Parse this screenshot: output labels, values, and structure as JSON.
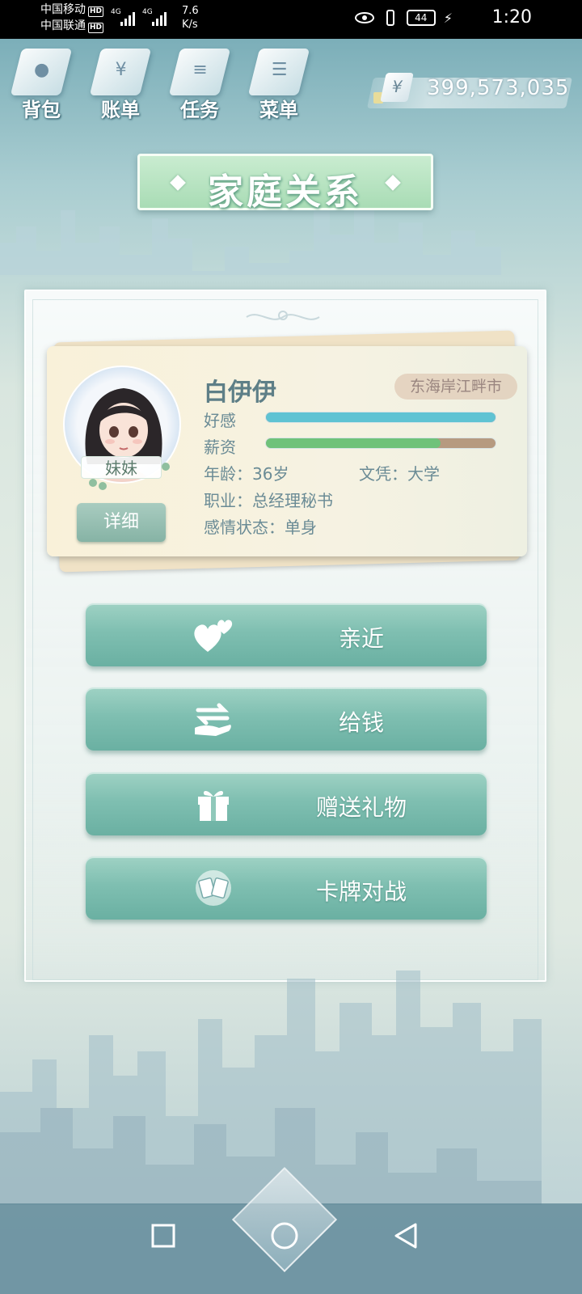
{
  "status_bar": {
    "carrier1": "中国移动",
    "carrier2": "中国联通",
    "hd": "HD",
    "net1": "4G",
    "net2": "4G",
    "speed_value": "7.6",
    "speed_unit": "K/s",
    "battery": "44",
    "time": "1:20"
  },
  "top_menu": {
    "items": [
      {
        "label": "背包",
        "icon": "bag-icon"
      },
      {
        "label": "账单",
        "icon": "bill-icon"
      },
      {
        "label": "任务",
        "icon": "task-icon"
      },
      {
        "label": "菜单",
        "icon": "menu-icon"
      }
    ],
    "currency_symbol": "¥",
    "money": "399,573,035"
  },
  "page": {
    "title": "家庭关系"
  },
  "profile": {
    "relation": "妹妹",
    "name": "白伊伊",
    "city": "东海岸江畔市",
    "favor_label": "好感",
    "favor_level": 1.0,
    "salary_label": "薪资",
    "salary_level": 0.76,
    "age": "年龄：36岁",
    "education": "文凭：大学",
    "job": "职业：总经理秘书",
    "relationship_status": "感情状态：单身",
    "detail_button": "详细"
  },
  "actions": [
    {
      "label": "亲近",
      "icon": "hearts-icon"
    },
    {
      "label": "给钱",
      "icon": "give-money-icon"
    },
    {
      "label": "赠送礼物",
      "icon": "gift-icon"
    },
    {
      "label": "卡牌对战",
      "icon": "card-battle-icon"
    }
  ],
  "colors": {
    "favor_bar": "#5fc3d3",
    "salary_bar": "#6fc27a",
    "button_teal": "#7fbfb1"
  }
}
